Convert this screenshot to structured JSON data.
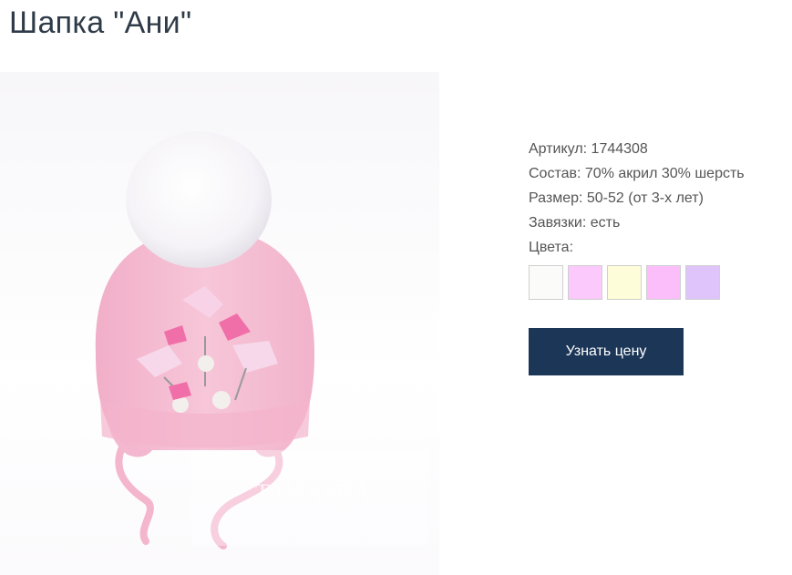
{
  "product": {
    "title": "Шапка \"Ани\"",
    "image": {
      "alt": "Шапка \"Ани\"",
      "watermark_text": "TAMASHA",
      "colors": {
        "hat": "#f4bfd3",
        "pompom": "#ffffff",
        "accent": "#f06fa8"
      }
    },
    "specs": [
      {
        "text": "Артикул: 1744308"
      },
      {
        "text": "Состав: 70% акрил 30% шерсть"
      },
      {
        "text": "Размер: 50-52 (от 3-х лет)"
      },
      {
        "text": "Завязки: есть"
      },
      {
        "text": "Цвета:"
      }
    ],
    "colors": [
      {
        "name": "white",
        "hex": "#fbfcfa"
      },
      {
        "name": "pink",
        "hex": "#fbc9fb"
      },
      {
        "name": "cream",
        "hex": "#fdfdda"
      },
      {
        "name": "light-pink",
        "hex": "#fbbefa"
      },
      {
        "name": "lavender",
        "hex": "#dfc4fb"
      }
    ],
    "button_label": "Узнать цену"
  }
}
